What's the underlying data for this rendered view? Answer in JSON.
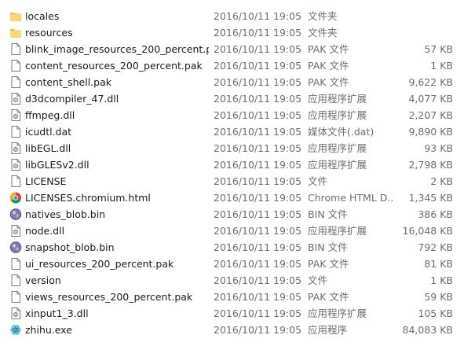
{
  "files": [
    {
      "name": "locales",
      "date": "2016/10/11 19:05",
      "type": "文件夹",
      "size": "",
      "icon": "folder-icon"
    },
    {
      "name": "resources",
      "date": "2016/10/11 19:05",
      "type": "文件夹",
      "size": "",
      "icon": "folder-icon"
    },
    {
      "name": "blink_image_resources_200_percent.p...",
      "date": "2016/10/11 19:05",
      "type": "PAK 文件",
      "size": "57 KB",
      "icon": "file-icon"
    },
    {
      "name": "content_resources_200_percent.pak",
      "date": "2016/10/11 19:05",
      "type": "PAK 文件",
      "size": "1 KB",
      "icon": "file-icon"
    },
    {
      "name": "content_shell.pak",
      "date": "2016/10/11 19:05",
      "type": "PAK 文件",
      "size": "9,622 KB",
      "icon": "file-icon"
    },
    {
      "name": "d3dcompiler_47.dll",
      "date": "2016/10/11 19:05",
      "type": "应用程序扩展",
      "size": "4,077 KB",
      "icon": "dll-icon"
    },
    {
      "name": "ffmpeg.dll",
      "date": "2016/10/11 19:05",
      "type": "应用程序扩展",
      "size": "2,207 KB",
      "icon": "dll-icon"
    },
    {
      "name": "icudtl.dat",
      "date": "2016/10/11 19:05",
      "type": "媒体文件(.dat)",
      "size": "9,890 KB",
      "icon": "file-icon"
    },
    {
      "name": "libEGL.dll",
      "date": "2016/10/11 19:05",
      "type": "应用程序扩展",
      "size": "93 KB",
      "icon": "dll-icon"
    },
    {
      "name": "libGLESv2.dll",
      "date": "2016/10/11 19:05",
      "type": "应用程序扩展",
      "size": "2,798 KB",
      "icon": "dll-icon"
    },
    {
      "name": "LICENSE",
      "date": "2016/10/11 19:05",
      "type": "文件",
      "size": "2 KB",
      "icon": "file-icon"
    },
    {
      "name": "LICENSES.chromium.html",
      "date": "2016/10/11 19:05",
      "type": "Chrome HTML D...",
      "size": "1,345 KB",
      "icon": "chrome-icon"
    },
    {
      "name": "natives_blob.bin",
      "date": "2016/10/11 19:05",
      "type": "BIN 文件",
      "size": "386 KB",
      "icon": "bin-icon"
    },
    {
      "name": "node.dll",
      "date": "2016/10/11 19:05",
      "type": "应用程序扩展",
      "size": "16,048 KB",
      "icon": "dll-icon"
    },
    {
      "name": "snapshot_blob.bin",
      "date": "2016/10/11 19:05",
      "type": "BIN 文件",
      "size": "792 KB",
      "icon": "bin-icon"
    },
    {
      "name": "ui_resources_200_percent.pak",
      "date": "2016/10/11 19:05",
      "type": "PAK 文件",
      "size": "81 KB",
      "icon": "file-icon"
    },
    {
      "name": "version",
      "date": "2016/10/11 19:05",
      "type": "文件",
      "size": "1 KB",
      "icon": "file-icon"
    },
    {
      "name": "views_resources_200_percent.pak",
      "date": "2016/10/11 19:05",
      "type": "PAK 文件",
      "size": "59 KB",
      "icon": "file-icon"
    },
    {
      "name": "xinput1_3.dll",
      "date": "2016/10/11 19:05",
      "type": "应用程序扩展",
      "size": "105 KB",
      "icon": "dll-icon"
    },
    {
      "name": "zhihu.exe",
      "date": "2016/10/11 19:05",
      "type": "应用程序",
      "size": "84,083 KB",
      "icon": "electron-icon"
    }
  ]
}
